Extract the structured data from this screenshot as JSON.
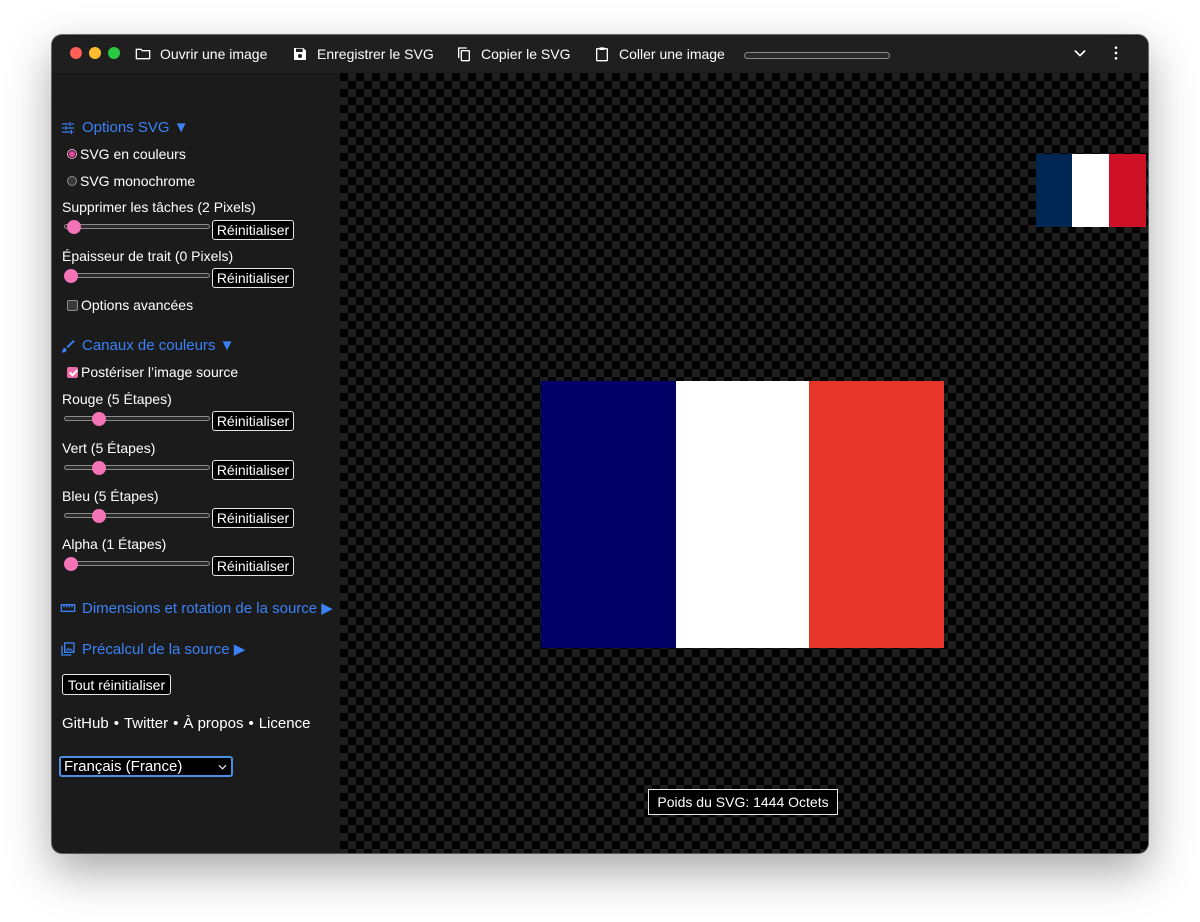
{
  "toolbar": {
    "open_label": "Ouvrir une image",
    "save_label": "Enregistrer le SVG",
    "copy_label": "Copier le SVG",
    "paste_label": "Coller une image"
  },
  "sidebar": {
    "svg_options": {
      "title": "Options SVG ▼",
      "color_label": "SVG en couleurs",
      "mono_label": "SVG monochrome",
      "selected_mode": "SVG en couleurs",
      "speckles_label": "Supprimer les tâches (2 Pixels)",
      "speckles_value": 2,
      "stroke_label": "Épaisseur de trait (0 Pixels)",
      "stroke_value": 0,
      "advanced_label": "Options avancées",
      "advanced_checked": false
    },
    "color_channels": {
      "title": "Canaux de couleurs ▼",
      "posterize_label": "Postériser l’image source",
      "posterize_checked": true,
      "red_label": "Rouge (5 Étapes)",
      "red_value": 5,
      "green_label": "Vert (5 Étapes)",
      "green_value": 5,
      "blue_label": "Bleu (5 Étapes)",
      "blue_value": 5,
      "alpha_label": "Alpha (1 Étapes)",
      "alpha_value": 1
    },
    "reset_label": "Réinitialiser",
    "resize_title": "Dimensions et rotation de la source ▶",
    "preprocess_title": "Précalcul de la source ▶",
    "reset_all_label": "Tout réinitialiser",
    "links": {
      "github": "GitHub",
      "twitter": "Twitter",
      "about": "À propos",
      "license": "Licence",
      "separator": "•"
    },
    "language": "Français (France)"
  },
  "canvas": {
    "svg_weight_label": "Poids du SVG: 1444 Octets",
    "thumb_flag_colors": [
      "#002654",
      "#ffffff",
      "#ce1126"
    ],
    "main_flag_colors": [
      "#000066",
      "#ffffff",
      "#e8352a"
    ]
  },
  "colors": {
    "accent": "#3b82f6",
    "slider_thumb": "#f472b6"
  }
}
